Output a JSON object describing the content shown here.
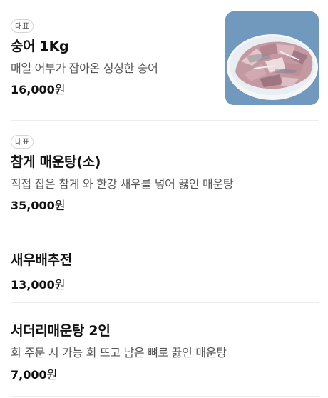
{
  "menu": {
    "items": [
      {
        "badge": "대표",
        "name": "숭어 1Kg",
        "description": "매일 어부가 잡아온 싱싱한 숭어",
        "price": "16,000",
        "currency": "원",
        "has_photo": true
      },
      {
        "badge": "대표",
        "name": "참게 매운탕(소)",
        "description": "직접 잡은 참게 와 한강 새우를 넣어 끓인 매운탕",
        "price": "35,000",
        "currency": "원"
      },
      {
        "name": "새우배추전",
        "price": "13,000",
        "currency": "원"
      },
      {
        "name": "서더리매운탕 2인",
        "description": "회 주문 시 가능 회 뜨고 남은 뼈로 끓인 매운탕",
        "price": "7,000",
        "currency": "원"
      }
    ]
  },
  "colors": {
    "title": "#111111",
    "description": "#555555",
    "divider": "#ededed",
    "photo_background": "#6f95b8"
  }
}
